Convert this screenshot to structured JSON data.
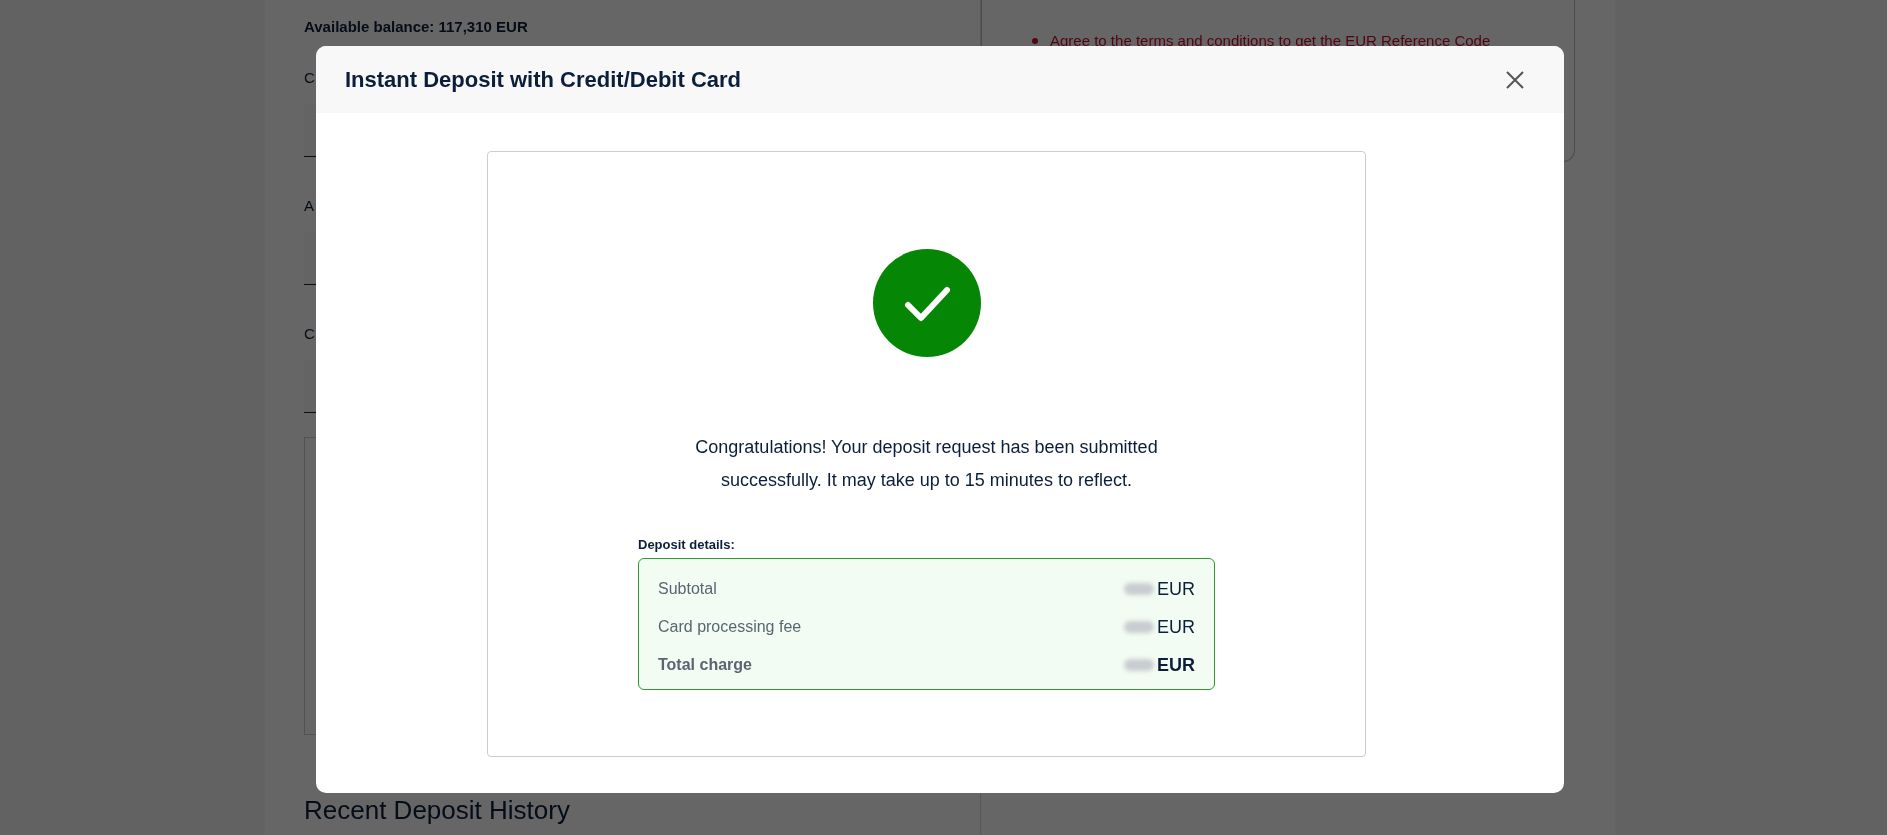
{
  "background": {
    "balance": "Available balance: 117,310 EUR",
    "field_labels": [
      "C",
      "A",
      "C"
    ],
    "notice": "Agree to the terms and conditions to get the EUR Reference Code",
    "history_title": "Recent Deposit History"
  },
  "modal": {
    "title": "Instant Deposit with Credit/Debit Card",
    "message": "Congratulations! Your deposit request has been submitted successfully. It may take up to 15 minutes to reflect.",
    "details_label": "Deposit details:",
    "rows": [
      {
        "label": "Subtotal",
        "currency": "EUR",
        "kind": "normal"
      },
      {
        "label": "Card processing fee",
        "currency": "EUR",
        "kind": "normal"
      },
      {
        "label": "Total charge",
        "currency": "EUR",
        "kind": "total"
      }
    ]
  }
}
